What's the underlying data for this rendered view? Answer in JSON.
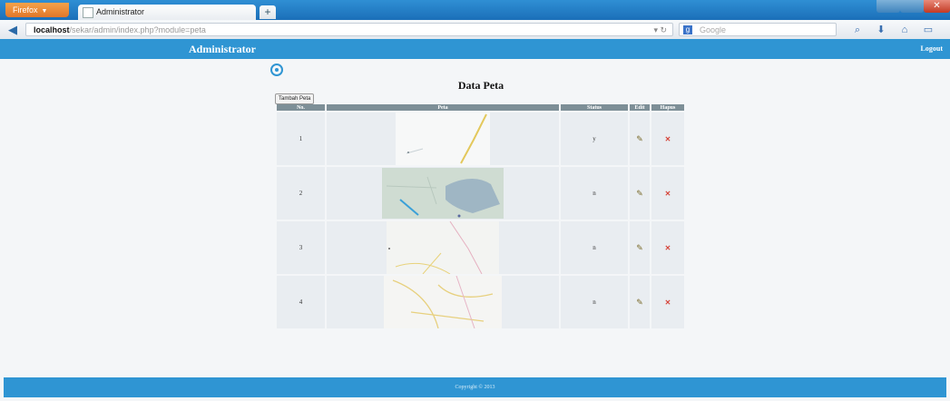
{
  "browser": {
    "app_button": "Firefox",
    "tab_title": "Administrator",
    "url_host": "localhost",
    "url_path": "/sekar/admin/index.php?module=peta",
    "search_placeholder": "Google"
  },
  "header": {
    "title": "Administrator",
    "logout": "Logout"
  },
  "page": {
    "title": "Data Peta",
    "add_button": "Tambah Peta"
  },
  "table": {
    "columns": [
      "No.",
      "Peta",
      "Status",
      "Edit",
      "Hapus"
    ],
    "rows": [
      {
        "no": "1",
        "status": "y"
      },
      {
        "no": "2",
        "status": "n"
      },
      {
        "no": "3",
        "status": "n"
      },
      {
        "no": "4",
        "status": "n"
      }
    ]
  },
  "footer": {
    "copyright": "Copyright © 2013"
  },
  "colors": {
    "accent": "#2f95d3",
    "table_header": "#7d8f97",
    "cell": "#e9edf1"
  }
}
